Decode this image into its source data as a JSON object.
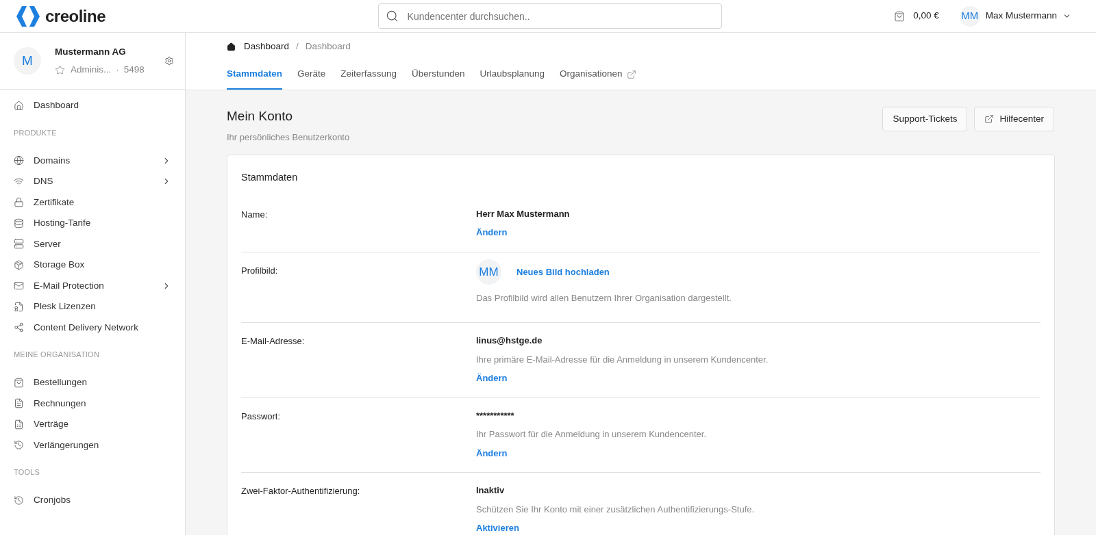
{
  "header": {
    "logo": "creoline",
    "search": {
      "placeholder": "Kundencenter durchsuchen.."
    },
    "cart_total": "0,00 €",
    "user": {
      "initials": "MM",
      "name": "Max Mustermann"
    }
  },
  "org": {
    "initial": "M",
    "name": "Mustermann AG",
    "role": "Adminis...",
    "separator": "·",
    "number": "5498"
  },
  "sidebar": {
    "top": [
      {
        "label": "Dashboard",
        "expandable": false
      }
    ],
    "sections": [
      {
        "title": "PRODUKTE",
        "items": [
          {
            "label": "Domains",
            "expandable": true
          },
          {
            "label": "DNS",
            "expandable": true
          },
          {
            "label": "Zertifikate",
            "expandable": false
          },
          {
            "label": "Hosting-Tarife",
            "expandable": false
          },
          {
            "label": "Server",
            "expandable": false
          },
          {
            "label": "Storage Box",
            "expandable": false
          },
          {
            "label": "E-Mail Protection",
            "expandable": true
          },
          {
            "label": "Plesk Lizenzen",
            "expandable": false
          },
          {
            "label": "Content Delivery Network",
            "expandable": false
          }
        ]
      },
      {
        "title": "MEINE ORGANISATION",
        "items": [
          {
            "label": "Bestellungen",
            "expandable": false
          },
          {
            "label": "Rechnungen",
            "expandable": false
          },
          {
            "label": "Verträge",
            "expandable": false
          },
          {
            "label": "Verlängerungen",
            "expandable": false
          }
        ]
      },
      {
        "title": "TOOLS",
        "items": [
          {
            "label": "Cronjobs",
            "expandable": false
          }
        ]
      }
    ]
  },
  "breadcrumb": {
    "separator": "/",
    "items": [
      "Dashboard",
      "Dashboard"
    ]
  },
  "tabs": [
    {
      "label": "Stammdaten",
      "selected": true,
      "external": false
    },
    {
      "label": "Geräte",
      "selected": false,
      "external": false
    },
    {
      "label": "Zeiterfassung",
      "selected": false,
      "external": false
    },
    {
      "label": "Überstunden",
      "selected": false,
      "external": false
    },
    {
      "label": "Urlaubsplanung",
      "selected": false,
      "external": false
    },
    {
      "label": "Organisationen",
      "selected": false,
      "external": true
    }
  ],
  "page": {
    "title": "Mein Konto",
    "subtitle": "Ihr persönliches Benutzerkonto",
    "buttons": [
      {
        "label": "Support-Tickets",
        "external": false
      },
      {
        "label": "Hilfecenter",
        "external": true
      }
    ]
  },
  "card": {
    "title": "Stammdaten",
    "rows": [
      {
        "kind": "value",
        "label": "Name:",
        "value": "Herr Max Mustermann",
        "action": "Ändern"
      },
      {
        "kind": "avatar",
        "label": "Profilbild:",
        "initials": "MM",
        "action": "Neues Bild hochladen",
        "description": "Das Profilbild wird allen Benutzern Ihrer Organisation dargestellt."
      },
      {
        "kind": "value",
        "label": "E-Mail-Adresse:",
        "value": "linus@hstge.de",
        "description": "Ihre primäre E-Mail-Adresse für die Anmeldung in unserem Kundencenter.",
        "action": "Ändern"
      },
      {
        "kind": "value",
        "label": "Passwort:",
        "value": "***********",
        "description": "Ihr Passwort für die Anmeldung in unserem Kundencenter.",
        "action": "Ändern"
      },
      {
        "kind": "value",
        "label": "Zwei-Faktor-Authentifizierung:",
        "value": "Inaktiv",
        "description": "Schützen Sie Ihr Konto mit einer zusätzlichen Authentifizierungs-Stufe.",
        "action": "Aktivieren"
      }
    ]
  }
}
